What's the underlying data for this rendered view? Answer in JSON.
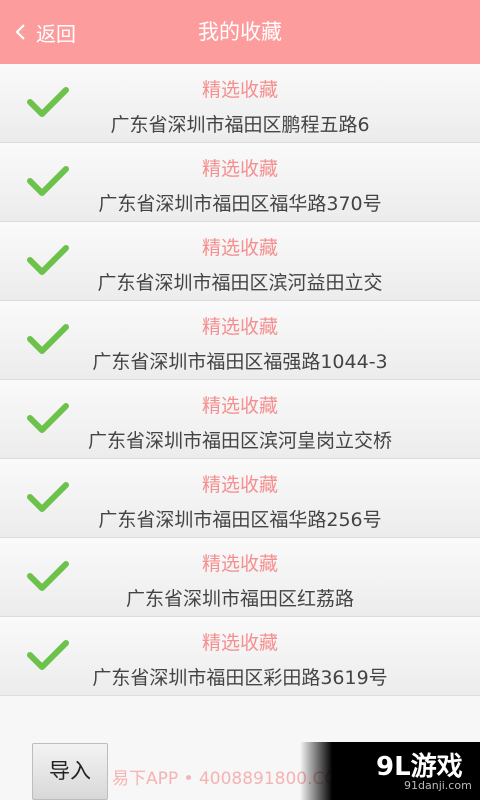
{
  "header": {
    "back_label": "返回",
    "title": "我的收藏",
    "background_color": "#fd9c9c"
  },
  "favorites": [
    {
      "title": "精选收藏",
      "address": "广东省深圳市福田区鹏程五路6"
    },
    {
      "title": "精选收藏",
      "address": "广东省深圳市福田区福华路370号"
    },
    {
      "title": "精选收藏",
      "address": "广东省深圳市福田区滨河益田立交"
    },
    {
      "title": "精选收藏",
      "address": "广东省深圳市福田区福强路1044-3"
    },
    {
      "title": "精选收藏",
      "address": "广东省深圳市福田区滨河皇岗立交桥"
    },
    {
      "title": "精选收藏",
      "address": "广东省深圳市福田区福华路256号"
    },
    {
      "title": "精选收藏",
      "address": "广东省深圳市福田区红荔路"
    },
    {
      "title": "精选收藏",
      "address": "广东省深圳市福田区彩田路3619号"
    }
  ],
  "footer": {
    "import_label": "导入",
    "watermark": "易下APP • 4008891800.COM",
    "logo_main": "9L游戏",
    "logo_sub": "91danji.com"
  },
  "colors": {
    "check": "#6cc24a",
    "title_text": "#f68f8f",
    "address_text": "#444444"
  }
}
